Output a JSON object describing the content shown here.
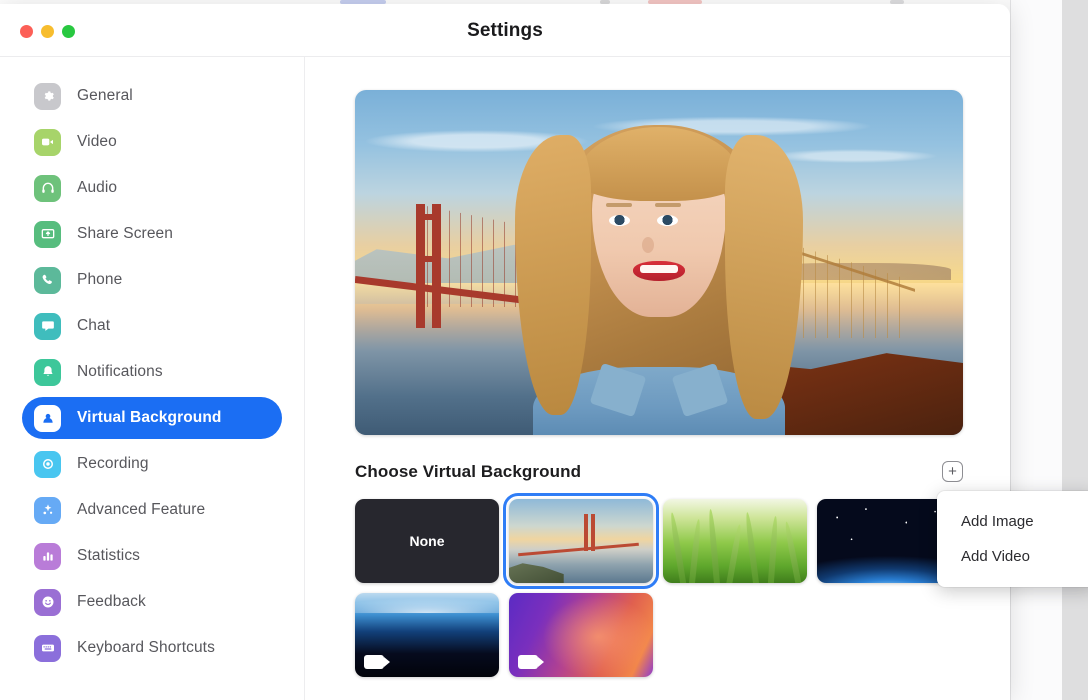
{
  "window": {
    "title": "Settings",
    "traffic_lights": [
      {
        "name": "close",
        "color": "#fc5f57"
      },
      {
        "name": "minimize",
        "color": "#f7bd2e"
      },
      {
        "name": "zoom",
        "color": "#28c840"
      }
    ]
  },
  "backdrop": {
    "gear_icon": "gear-icon",
    "avatar": "user-avatar-thumbnail"
  },
  "sidebar": {
    "items": [
      {
        "label": "General",
        "icon": "gear-icon",
        "color": "#c8c8cc",
        "active": false
      },
      {
        "label": "Video",
        "icon": "video-camera-icon",
        "color": "#a7d46a",
        "active": false
      },
      {
        "label": "Audio",
        "icon": "headphones-icon",
        "color": "#6ec27b",
        "active": false
      },
      {
        "label": "Share Screen",
        "icon": "share-screen-icon",
        "color": "#57bd7e",
        "active": false
      },
      {
        "label": "Phone",
        "icon": "phone-icon",
        "color": "#5cb99a",
        "active": false
      },
      {
        "label": "Chat",
        "icon": "chat-bubble-icon",
        "color": "#3fbdbd",
        "active": false
      },
      {
        "label": "Notifications",
        "icon": "bell-icon",
        "color": "#3dc79a",
        "active": false
      },
      {
        "label": "Virtual Background",
        "icon": "person-badge-icon",
        "color": "#1b6ef3",
        "active": true
      },
      {
        "label": "Recording",
        "icon": "record-circle-icon",
        "color": "#49c6f0",
        "active": false
      },
      {
        "label": "Advanced Feature",
        "icon": "sparkle-icon",
        "color": "#66aaf5",
        "active": false
      },
      {
        "label": "Statistics",
        "icon": "bar-chart-icon",
        "color": "#b97cd8",
        "active": false
      },
      {
        "label": "Feedback",
        "icon": "smiley-icon",
        "color": "#9a6fd4",
        "active": false
      },
      {
        "label": "Keyboard Shortcuts",
        "icon": "keyboard-icon",
        "color": "#8b6fdb",
        "active": false
      }
    ],
    "active_color": "#1b6ef3"
  },
  "content": {
    "preview": {
      "name": "video-preview",
      "description": "Golden Gate Bridge sunset virtual background with person"
    },
    "section": {
      "title": "Choose Virtual Background",
      "add_button_label": "+"
    },
    "thumbnails": [
      {
        "label": "None",
        "style": "none",
        "selected": false,
        "is_video": false
      },
      {
        "label": "Golden Gate",
        "style": "gg",
        "selected": true,
        "is_video": false
      },
      {
        "label": "Grass",
        "style": "grass",
        "selected": false,
        "is_video": false
      },
      {
        "label": "Earth from Space",
        "style": "earth",
        "selected": false,
        "is_video": false
      },
      {
        "label": "Earth Horizon",
        "style": "earth2",
        "selected": false,
        "is_video": true
      },
      {
        "label": "Aurora Gradient",
        "style": "aurora",
        "selected": false,
        "is_video": true
      }
    ],
    "selection_color": "#2f7df6"
  },
  "dropdown": {
    "visible": true,
    "items": [
      {
        "label": "Add Image"
      },
      {
        "label": "Add Video"
      }
    ]
  }
}
